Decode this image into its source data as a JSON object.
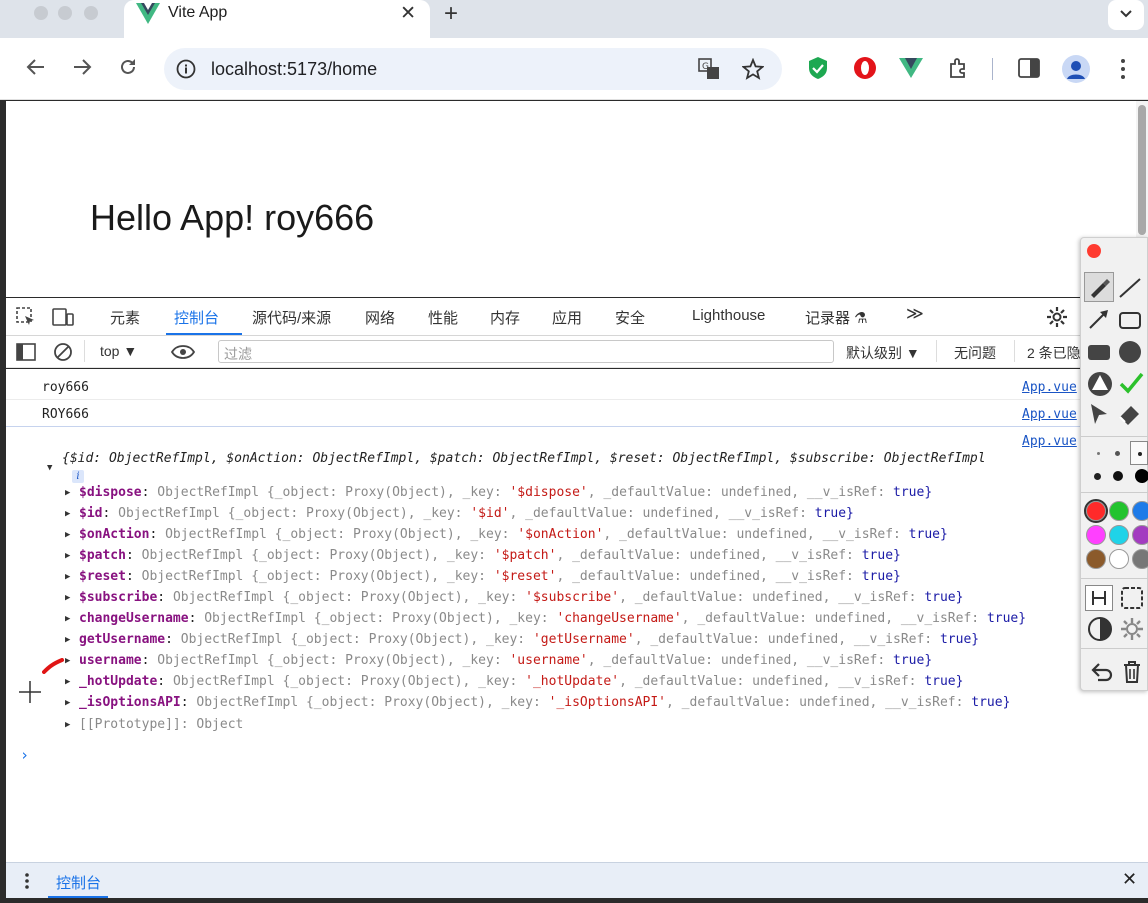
{
  "browser": {
    "tab_title": "Vite App",
    "url": "localhost:5173/home",
    "new_tab_label": "+",
    "close_tab_label": "✕"
  },
  "page": {
    "heading": "Hello App! roy666"
  },
  "devtools": {
    "tabs": [
      "元素",
      "控制台",
      "源代码/来源",
      "网络",
      "性能",
      "内存",
      "应用",
      "安全",
      "Lighthouse",
      "记录器 ⚗"
    ],
    "more_tabs": "≫",
    "context": "top ▼",
    "filter_placeholder": "过滤",
    "level": "默认级别 ▼",
    "no_issues": "无问题",
    "count": "2 条已隐"
  },
  "console": {
    "logs": [
      {
        "text": "roy666",
        "source": "App.vue"
      },
      {
        "text": "ROY666",
        "source": "App.vue"
      }
    ],
    "object_source": "App.vue",
    "object_summary": "{$id: ObjectRefImpl, $onAction: ObjectRefImpl, $patch: ObjectRefImpl, $reset: ObjectRefImpl, $subscribe: ObjectRefImpl",
    "properties": [
      {
        "key": "$dispose",
        "value_prefix": "ObjectRefImpl {_object: Proxy(Object), _key: ",
        "str": "'$dispose'",
        "value_suffix": ", _defaultValue: ",
        "undef": "undefined",
        "tail": ", __v_isRef: ",
        "bool": "true}"
      },
      {
        "key": "$id",
        "value_prefix": "ObjectRefImpl {_object: Proxy(Object), _key: ",
        "str": "'$id'",
        "value_suffix": ", _defaultValue: ",
        "undef": "undefined",
        "tail": ", __v_isRef: ",
        "bool": "true}"
      },
      {
        "key": "$onAction",
        "value_prefix": "ObjectRefImpl {_object: Proxy(Object), _key: ",
        "str": "'$onAction'",
        "value_suffix": ", _defaultValue: ",
        "undef": "undefined",
        "tail": ", __v_isRef: ",
        "bool": "true}"
      },
      {
        "key": "$patch",
        "value_prefix": "ObjectRefImpl {_object: Proxy(Object), _key: ",
        "str": "'$patch'",
        "value_suffix": ", _defaultValue: ",
        "undef": "undefined",
        "tail": ", __v_isRef: ",
        "bool": "true}"
      },
      {
        "key": "$reset",
        "value_prefix": "ObjectRefImpl {_object: Proxy(Object), _key: ",
        "str": "'$reset'",
        "value_suffix": ", _defaultValue: ",
        "undef": "undefined",
        "tail": ", __v_isRef: ",
        "bool": "true}"
      },
      {
        "key": "$subscribe",
        "value_prefix": "ObjectRefImpl {_object: Proxy(Object), _key: ",
        "str": "'$subscribe'",
        "value_suffix": ", _defaultValue: ",
        "undef": "undefined",
        "tail": ", __v_isRef: ",
        "bool": "true}"
      },
      {
        "key": "changeUsername",
        "value_prefix": "ObjectRefImpl {_object: Proxy(Object), _key: ",
        "str": "'changeUsername'",
        "value_suffix": ", _defaultValue: ",
        "undef": "undefined",
        "tail": ", __v_isRef: ",
        "bool": "true}"
      },
      {
        "key": "getUsername",
        "value_prefix": "ObjectRefImpl {_object: Proxy(Object), _key: ",
        "str": "'getUsername'",
        "value_suffix": ", _defaultValue: ",
        "undef": "undefined",
        "tail": ", __v_isRef: ",
        "bool": "true}"
      },
      {
        "key": "username",
        "value_prefix": "ObjectRefImpl {_object: Proxy(Object), _key: ",
        "str": "'username'",
        "value_suffix": ", _defaultValue: ",
        "undef": "undefined",
        "tail": ", __v_isRef: ",
        "bool": "true}"
      },
      {
        "key": "_hotUpdate",
        "value_prefix": "ObjectRefImpl {_object: Proxy(Object), _key: ",
        "str": "'_hotUpdate'",
        "value_suffix": ", _defaultValue: ",
        "undef": "undefined",
        "tail": ", __v_isRef: ",
        "bool": "true}"
      },
      {
        "key": "_isOptionsAPI",
        "value_prefix": "ObjectRefImpl {_object: Proxy(Object), _key: ",
        "str": "'_isOptionsAPI'",
        "value_suffix": ", _defaultValue: ",
        "undef": "undefined",
        "tail": ", __v_isRef: ",
        "bool": "true}"
      }
    ],
    "prototype": "[[Prototype]]: Object",
    "prompt": "›"
  },
  "drawer": {
    "tab": "控制台",
    "close": "✕"
  },
  "palette_colors": [
    "#ff2a2a",
    "#22c32e",
    "#1e7be8",
    "#ff40ff",
    "#1fd3e8",
    "#a33cc0",
    "#8b5a2b",
    "#ffffff",
    "#777777"
  ]
}
